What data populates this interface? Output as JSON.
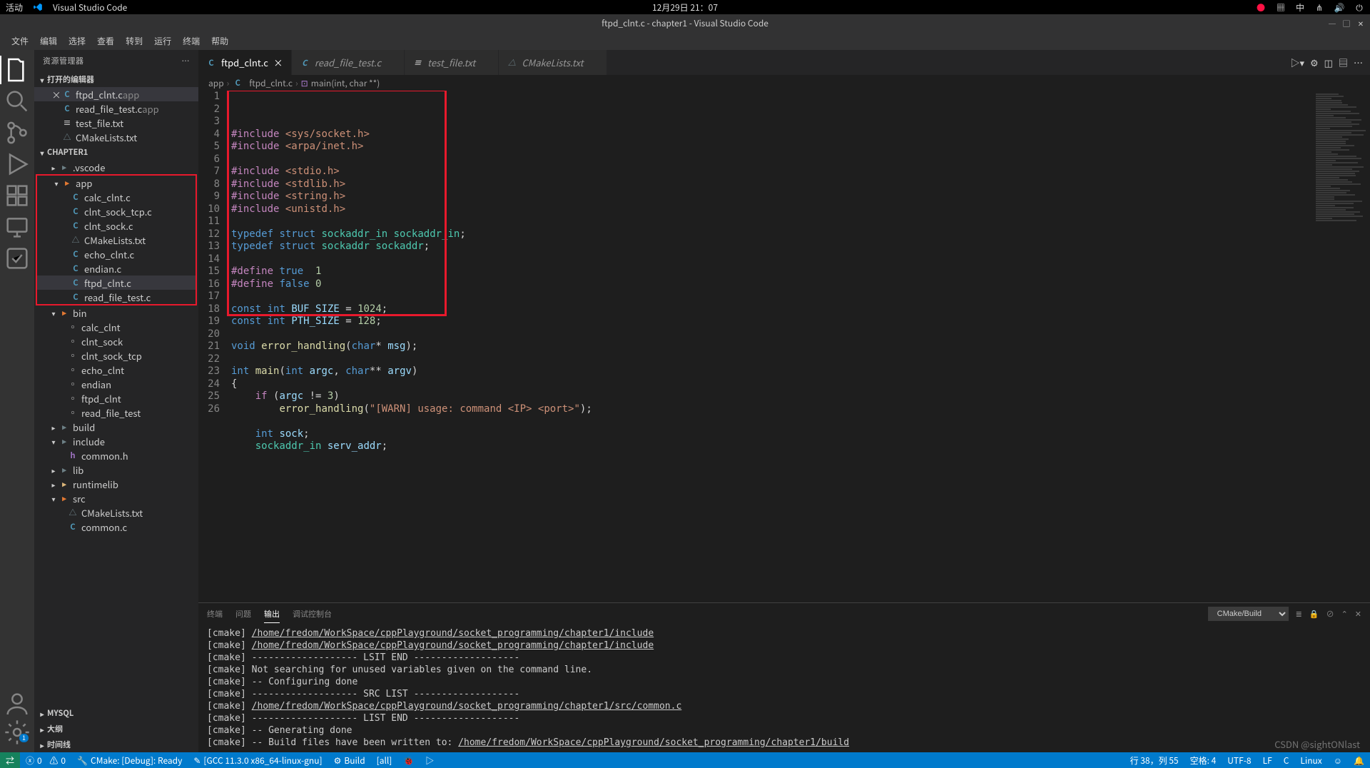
{
  "os": {
    "activity": "活动",
    "app_name": "Visual Studio Code",
    "datetime": "12月29日  21：07",
    "lang": "中"
  },
  "title": "ftpd_clnt.c - chapter1 - Visual Studio Code",
  "menu": [
    "文件",
    "编辑",
    "选择",
    "查看",
    "转到",
    "运行",
    "终端",
    "帮助"
  ],
  "sidebar": {
    "title": "资源管理器",
    "open_editors_label": "打开的编辑器",
    "open_editors": [
      {
        "name": "ftpd_clnt.c",
        "hint": "app",
        "icon": "C",
        "iconClass": "icon-c",
        "active": true,
        "close": true
      },
      {
        "name": "read_file_test.c",
        "hint": "app",
        "icon": "C",
        "iconClass": "icon-c"
      },
      {
        "name": "test_file.txt",
        "icon": "≡",
        "iconClass": "icon-txt"
      },
      {
        "name": "CMakeLists.txt",
        "icon": "△",
        "iconClass": "icon-cmake"
      }
    ],
    "project": "CHAPTER1",
    "tree": [
      {
        "d": 1,
        "folder": true,
        "open": false,
        "name": ".vscode",
        "iconClass": "icon-folder-special"
      },
      {
        "d": 1,
        "folder": true,
        "open": true,
        "name": "app",
        "iconClass": "icon-folder-git",
        "boxStart": true
      },
      {
        "d": 2,
        "icon": "C",
        "iconClass": "icon-c",
        "name": "calc_clnt.c"
      },
      {
        "d": 2,
        "icon": "C",
        "iconClass": "icon-c",
        "name": "clnt_sock_tcp.c"
      },
      {
        "d": 2,
        "icon": "C",
        "iconClass": "icon-c",
        "name": "clnt_sock.c"
      },
      {
        "d": 2,
        "icon": "△",
        "iconClass": "icon-cmake",
        "name": "CMakeLists.txt"
      },
      {
        "d": 2,
        "icon": "C",
        "iconClass": "icon-c",
        "name": "echo_clnt.c"
      },
      {
        "d": 2,
        "icon": "C",
        "iconClass": "icon-c",
        "name": "endian.c"
      },
      {
        "d": 2,
        "icon": "C",
        "iconClass": "icon-c",
        "name": "ftpd_clnt.c",
        "selected": true
      },
      {
        "d": 2,
        "icon": "C",
        "iconClass": "icon-c",
        "name": "read_file_test.c",
        "boxEnd": true
      },
      {
        "d": 1,
        "folder": true,
        "open": true,
        "name": "bin",
        "iconClass": "icon-folder-git"
      },
      {
        "d": 2,
        "icon": "▫",
        "iconClass": "icon-txt",
        "name": "calc_clnt"
      },
      {
        "d": 2,
        "icon": "▫",
        "iconClass": "icon-txt",
        "name": "clnt_sock"
      },
      {
        "d": 2,
        "icon": "▫",
        "iconClass": "icon-txt",
        "name": "clnt_sock_tcp"
      },
      {
        "d": 2,
        "icon": "▫",
        "iconClass": "icon-txt",
        "name": "echo_clnt"
      },
      {
        "d": 2,
        "icon": "▫",
        "iconClass": "icon-txt",
        "name": "endian"
      },
      {
        "d": 2,
        "icon": "▫",
        "iconClass": "icon-txt",
        "name": "ftpd_clnt"
      },
      {
        "d": 2,
        "icon": "▫",
        "iconClass": "icon-txt",
        "name": "read_file_test"
      },
      {
        "d": 1,
        "folder": true,
        "open": false,
        "name": "build",
        "iconClass": "icon-folder-special"
      },
      {
        "d": 1,
        "folder": true,
        "open": true,
        "name": "include",
        "iconClass": "icon-folder-special"
      },
      {
        "d": 2,
        "icon": "h",
        "iconClass": "icon-h",
        "name": "common.h"
      },
      {
        "d": 1,
        "folder": true,
        "open": false,
        "name": "lib",
        "iconClass": "icon-folder-special"
      },
      {
        "d": 1,
        "folder": true,
        "open": false,
        "name": "runtimelib",
        "iconClass": "icon-folder"
      },
      {
        "d": 1,
        "folder": true,
        "open": true,
        "name": "src",
        "iconClass": "icon-folder-git"
      },
      {
        "d": 2,
        "icon": "△",
        "iconClass": "icon-cmake",
        "name": "CMakeLists.txt"
      },
      {
        "d": 2,
        "icon": "C",
        "iconClass": "icon-c",
        "name": "common.c"
      }
    ],
    "extra_sections": [
      "MYSQL",
      "大纲",
      "时间线"
    ]
  },
  "tabs": [
    {
      "name": "ftpd_clnt.c",
      "icon": "C",
      "iconClass": "icon-c",
      "active": true
    },
    {
      "name": "read_file_test.c",
      "icon": "C",
      "iconClass": "icon-c"
    },
    {
      "name": "test_file.txt",
      "icon": "≡",
      "iconClass": "icon-txt"
    },
    {
      "name": "CMakeLists.txt",
      "icon": "△",
      "iconClass": "icon-cmake"
    }
  ],
  "breadcrumb": [
    "app",
    "ftpd_clnt.c",
    "main(int, char **)"
  ],
  "code": [
    {
      "n": 1,
      "html": "<span class='tok-pp'>#include</span> <span class='tok-inc'>&lt;sys/socket.h&gt;</span>"
    },
    {
      "n": 2,
      "html": "<span class='tok-pp'>#include</span> <span class='tok-inc'>&lt;arpa/inet.h&gt;</span>"
    },
    {
      "n": 3,
      "html": ""
    },
    {
      "n": 4,
      "html": "<span class='tok-pp'>#include</span> <span class='tok-inc'>&lt;stdio.h&gt;</span>"
    },
    {
      "n": 5,
      "html": "<span class='tok-pp'>#include</span> <span class='tok-inc'>&lt;stdlib.h&gt;</span>"
    },
    {
      "n": 6,
      "html": "<span class='tok-pp'>#include</span> <span class='tok-inc'>&lt;string.h&gt;</span>"
    },
    {
      "n": 7,
      "html": "<span class='tok-pp'>#include</span> <span class='tok-inc'>&lt;unistd.h&gt;</span>"
    },
    {
      "n": 8,
      "html": ""
    },
    {
      "n": 9,
      "html": "<span class='tok-kw'>typedef</span> <span class='tok-kw'>struct</span> <span class='tok-type'>sockaddr_in</span> <span class='tok-type'>sockaddr_in</span>;"
    },
    {
      "n": 10,
      "html": "<span class='tok-kw'>typedef</span> <span class='tok-kw'>struct</span> <span class='tok-type'>sockaddr</span> <span class='tok-type'>sockaddr</span>;"
    },
    {
      "n": 11,
      "html": ""
    },
    {
      "n": 12,
      "html": "<span class='tok-pp'>#define</span> <span class='tok-kw'>true</span>  <span class='tok-num'>1</span>"
    },
    {
      "n": 13,
      "html": "<span class='tok-pp'>#define</span> <span class='tok-kw'>false</span> <span class='tok-num'>0</span>"
    },
    {
      "n": 14,
      "html": ""
    },
    {
      "n": 15,
      "html": "<span class='tok-kw'>const</span> <span class='tok-kw'>int</span> <span class='tok-var'>BUF_SIZE</span> = <span class='tok-num'>1024</span>;"
    },
    {
      "n": 16,
      "html": "<span class='tok-kw'>const</span> <span class='tok-kw'>int</span> <span class='tok-var'>PTH_SIZE</span> = <span class='tok-num'>128</span>;"
    },
    {
      "n": 17,
      "html": ""
    },
    {
      "n": 18,
      "html": "<span class='tok-kw'>void</span> <span class='tok-fn'>error_handling</span>(<span class='tok-kw'>char</span>* <span class='tok-var'>msg</span>);"
    },
    {
      "n": 19,
      "html": ""
    },
    {
      "n": 20,
      "html": "<span class='tok-kw'>int</span> <span class='tok-fn'>main</span>(<span class='tok-kw'>int</span> <span class='tok-var'>argc</span>, <span class='tok-kw'>char</span>** <span class='tok-var'>argv</span>)"
    },
    {
      "n": 21,
      "html": "{"
    },
    {
      "n": 22,
      "html": "    <span class='tok-pp'>if</span> (<span class='tok-var'>argc</span> != <span class='tok-num'>3</span>)"
    },
    {
      "n": 23,
      "html": "        <span class='tok-fn'>error_handling</span>(<span class='tok-str'>\"[WARN] usage: command &lt;IP&gt; &lt;port&gt;\"</span>);"
    },
    {
      "n": 24,
      "html": ""
    },
    {
      "n": 25,
      "html": "    <span class='tok-kw'>int</span> <span class='tok-var'>sock</span>;"
    },
    {
      "n": 26,
      "html": "    <span class='tok-type'>sockaddr_in</span> <span class='tok-var'>serv_addr</span>;"
    }
  ],
  "panel": {
    "tabs": [
      "终端",
      "问题",
      "输出",
      "调试控制台"
    ],
    "active_tab": 2,
    "select": "CMake/Build",
    "lines": [
      {
        "pre": "[cmake] ",
        "link": "/home/fredom/WorkSpace/cppPlayground/socket_programming/chapter1/include"
      },
      {
        "pre": "[cmake] ",
        "link": "/home/fredom/WorkSpace/cppPlayground/socket_programming/chapter1/include"
      },
      {
        "pre": "[cmake] ------------------- LSIT END -------------------"
      },
      {
        "pre": "[cmake] Not searching for unused variables given on the command line."
      },
      {
        "pre": "[cmake] -- Configuring done"
      },
      {
        "pre": "[cmake] ------------------- SRC LIST -------------------"
      },
      {
        "pre": "[cmake] ",
        "link": "/home/fredom/WorkSpace/cppPlayground/socket_programming/chapter1/src/common.c"
      },
      {
        "pre": "[cmake] ------------------- LIST END -------------------"
      },
      {
        "pre": "[cmake] -- Generating done"
      },
      {
        "pre": "[cmake] -- Build files have been written to: ",
        "link": "/home/fredom/WorkSpace/cppPlayground/socket_programming/chapter1/build"
      }
    ]
  },
  "status": {
    "errors": "0",
    "warnings": "0",
    "cmake": "CMake: [Debug]: Ready",
    "kit": "[GCC 11.3.0 x86_64-linux-gnu]",
    "build": "Build",
    "target": "[all]",
    "pos": "行 38，列 55",
    "spaces": "空格: 4",
    "encoding": "UTF-8",
    "eol": "LF",
    "lang": "C",
    "os": "Linux"
  },
  "watermark": "CSDN @sightONlast"
}
